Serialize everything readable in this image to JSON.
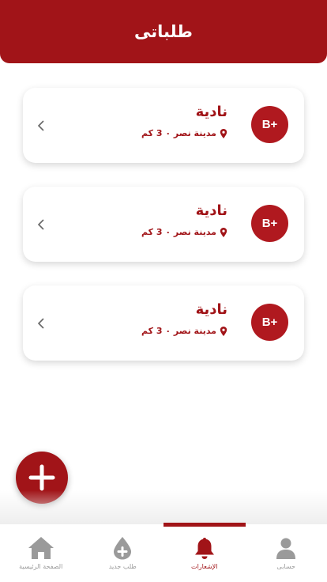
{
  "header": {
    "title": "طلباتى"
  },
  "requests": [
    {
      "blood_type": "B+",
      "name": "نادية",
      "location": "مدينة نصر ٠ 3 كم"
    },
    {
      "blood_type": "B+",
      "name": "نادية",
      "location": "مدينة نصر ٠ 3 كم"
    },
    {
      "blood_type": "B+",
      "name": "نادية",
      "location": "مدينة نصر ٠ 3 كم"
    }
  ],
  "fab": {
    "icon": "plus-icon"
  },
  "nav": {
    "items": [
      {
        "label": "حسابى",
        "icon": "person-icon",
        "active": false
      },
      {
        "label": "الإشعارات",
        "icon": "bell-icon",
        "active": true
      },
      {
        "label": "طلب جديد",
        "icon": "blood-drop-plus-icon",
        "active": false
      },
      {
        "label": "الصفحة الرئيسية",
        "icon": "home-icon",
        "active": false
      }
    ]
  },
  "colors": {
    "primary": "#a11418",
    "badge": "#b0191f",
    "inactive": "#9a9a9a"
  }
}
